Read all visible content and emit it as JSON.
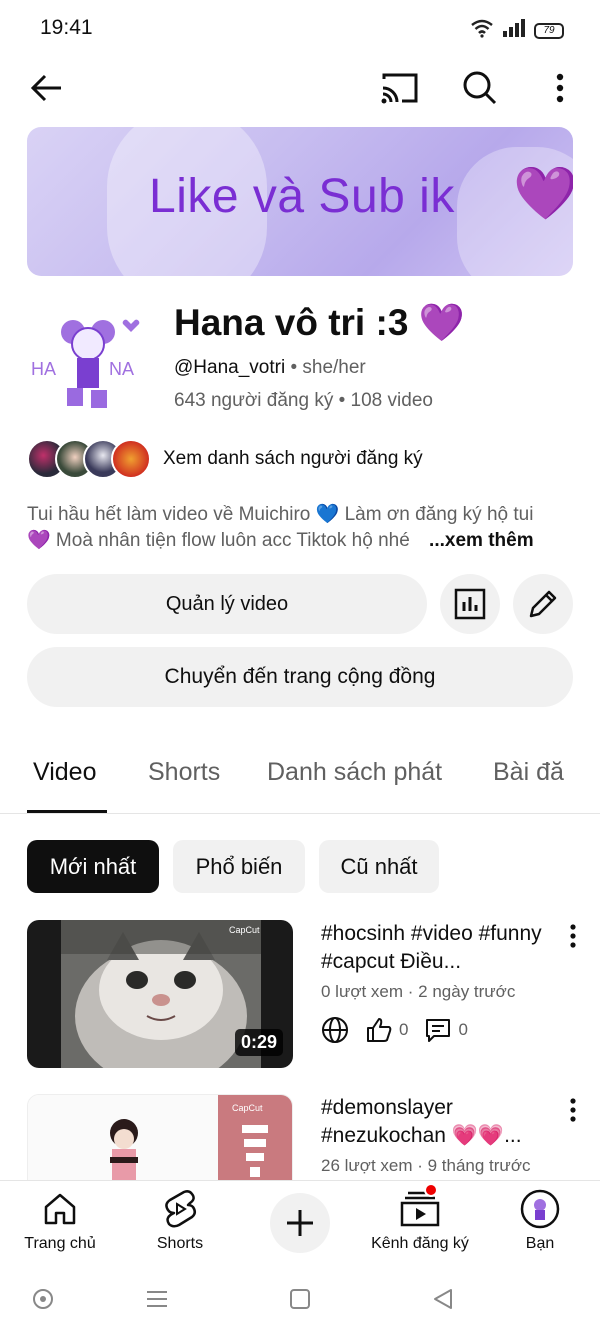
{
  "status": {
    "time": "19:41",
    "battery": "79"
  },
  "banner": {
    "text": "Like và Sub ik",
    "heart": "💜"
  },
  "channel": {
    "name": "Hana vô tri :3",
    "name_emoji": "💜",
    "handle": "@Hana_votri",
    "pronouns": "• she/her",
    "stats": "643 người đăng ký • 108 video",
    "avatar_text_left": "HA",
    "avatar_text_right": "NA"
  },
  "subscribers": {
    "link_label": "Xem danh sách người đăng ký"
  },
  "description": {
    "line1": "Tui hầu hết làm video về Muichiro 💙 Làm ơn đăng ký hộ tui",
    "line2": "💜 Moà nhân tiện flow luôn acc Tiktok hộ nhé",
    "more": "...xem thêm"
  },
  "actions": {
    "manage_label": "Quản lý video",
    "community_label": "Chuyển đến trang cộng đồng"
  },
  "tabs": [
    "Video",
    "Shorts",
    "Danh sách phát",
    "Bài đă"
  ],
  "chips": [
    "Mới nhất",
    "Phổ biến",
    "Cũ nhất"
  ],
  "videos": [
    {
      "title": "#hocsinh #video #funny #capcut Điều...",
      "meta": "0 lượt xem · 2 ngày trước",
      "likes": "0",
      "comments": "0",
      "duration": "0:29",
      "watermark": "CapCut"
    },
    {
      "title": "#demonslayer #nezukochan 💗💗...",
      "meta": "26 lượt xem · 9 tháng trước",
      "watermark": "CapCut"
    }
  ],
  "bottom_nav": {
    "home": "Trang chủ",
    "shorts": "Shorts",
    "subscriptions": "Kênh đăng ký",
    "you": "Bạn"
  },
  "colors": {
    "accent_purple": "#7a1fc7",
    "text_secondary": "#606060",
    "chip_bg": "#f1f1f1"
  }
}
